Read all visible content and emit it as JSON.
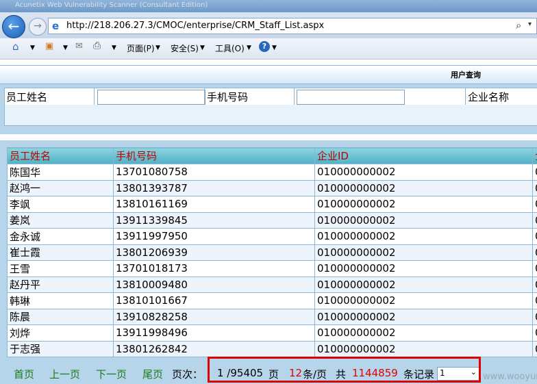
{
  "browser": {
    "title": "Acunetix Web Vulnerability Scanner (Consultant Edition)",
    "address": "http://218.206.27.3/CMOC/enterprise/CRM_Staff_List.aspx",
    "menu": {
      "page": "页面(P)",
      "safety": "安全(S)",
      "tools": "工具(O)",
      "help": "?"
    }
  },
  "query": {
    "title": "用户查询",
    "labels": {
      "name": "员工姓名",
      "phone": "手机号码",
      "company": "企业名称"
    },
    "values": {
      "name": "",
      "phone": ""
    }
  },
  "grid": {
    "columns": [
      "员工姓名",
      "手机号码",
      "企业ID",
      "企"
    ],
    "rows": [
      [
        "陈国华",
        "13701080758",
        "010000000002",
        "0"
      ],
      [
        "赵鸿一",
        "13801393787",
        "010000000002",
        "0"
      ],
      [
        "李飒",
        "13810161169",
        "010000000002",
        "0"
      ],
      [
        "姜岚",
        "13911339845",
        "010000000002",
        "0"
      ],
      [
        "金永诚",
        "13911997950",
        "010000000002",
        "0"
      ],
      [
        "崔士霞",
        "13801206939",
        "010000000002",
        "0"
      ],
      [
        "王雪",
        "13701018173",
        "010000000002",
        "0"
      ],
      [
        "赵丹平",
        "13810009480",
        "010000000002",
        "0"
      ],
      [
        "韩琳",
        "13810101667",
        "010000000002",
        "0"
      ],
      [
        "陈晨",
        "13910828258",
        "010000000002",
        "0"
      ],
      [
        "刘烨",
        "13911998496",
        "010000000002",
        "0"
      ],
      [
        "于志强",
        "13801262842",
        "010000000002",
        "0"
      ]
    ]
  },
  "pager": {
    "first": "首页",
    "prev": "上一页",
    "next": "下一页",
    "last": "尾页",
    "page_label": "页次：",
    "page_info": "1 /95405",
    "page_unit": "页",
    "per_page": "12",
    "per_page_unit": "条/页",
    "total_label": "共",
    "total": "1144859",
    "total_unit": "条记录",
    "select_value": "1"
  },
  "watermark": "www.wooyun.org",
  "colors": {
    "header_text": "#c00000",
    "pager_link": "#1a7a1a",
    "highlight": "#e00000",
    "panel": "#b7d5ea"
  }
}
